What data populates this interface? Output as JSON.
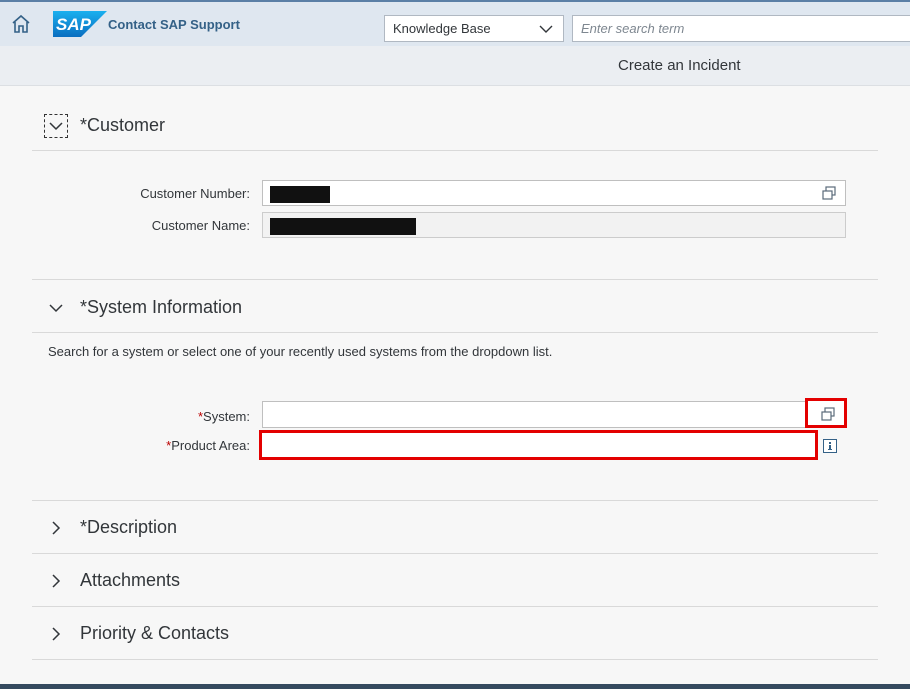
{
  "shell": {
    "logo_text": "SAP",
    "app_title": "Contact SAP Support",
    "search_scope": "Knowledge Base",
    "search_placeholder": "Enter search term"
  },
  "page": {
    "title": "Create an Incident"
  },
  "sections": {
    "customer": {
      "title": "*Customer",
      "number_label": "Customer Number:",
      "name_label": "Customer Name:"
    },
    "system_information": {
      "title": "*System Information",
      "hint": "Search for a system or select one of your recently used systems from the dropdown list.",
      "system_req": "*",
      "system_label": "System:",
      "system_value": "",
      "product_area_req": "*",
      "product_area_label": "Product Area:",
      "product_area_value": ""
    },
    "description": {
      "title": "*Description"
    },
    "attachments": {
      "title": "Attachments"
    },
    "priority_contacts": {
      "title": "Priority & Contacts"
    }
  },
  "colors": {
    "shell_bg": "#dfe7f0",
    "brand_blue": "#346187",
    "required_red": "#bb0000",
    "highlight_red": "#e30000"
  }
}
